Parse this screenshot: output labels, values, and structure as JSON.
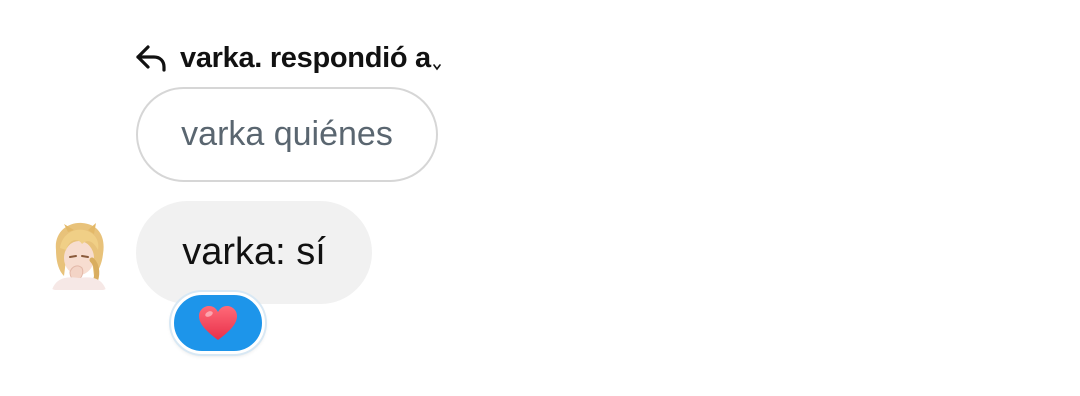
{
  "reply": {
    "header_text": "varka. respondió a",
    "icon": "reply-arrow-icon",
    "quoted_text": "varka quiénes"
  },
  "message": {
    "avatar": "user-avatar",
    "text": "varka: sí"
  },
  "reaction": {
    "icon": "heart-icon",
    "pill_color": "#1d95ea",
    "heart_color": "#f0405a"
  },
  "colors": {
    "bubble_bg": "#f1f1f1",
    "quoted_text": "#5a6670",
    "quoted_border": "#d6d6d6"
  }
}
